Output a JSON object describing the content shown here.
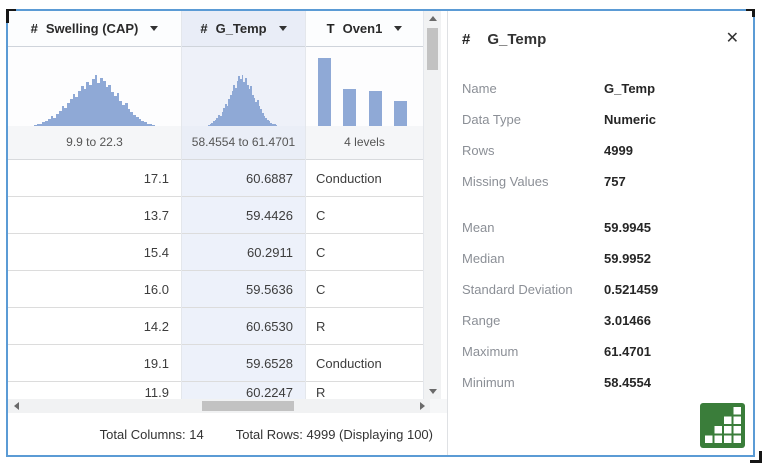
{
  "colors": {
    "accent_bar": "#8fa9d6",
    "frame_border": "#5b9bd5",
    "chart_icon_green": "#3a7d3a"
  },
  "table": {
    "columns": [
      {
        "icon": "#",
        "label": "Swelling (CAP)",
        "range": "9.9 to 22.3",
        "selected": false,
        "kind": "numeric",
        "hist_bars": [
          2,
          3,
          4,
          6,
          8,
          10,
          14,
          12,
          18,
          22,
          28,
          25,
          33,
          38,
          45,
          41,
          50,
          56,
          52,
          62,
          58,
          66,
          72,
          60,
          68,
          63,
          55,
          58,
          48,
          43,
          46,
          36,
          30,
          33,
          24,
          20,
          16,
          13,
          10,
          8,
          6,
          4,
          3,
          2
        ]
      },
      {
        "icon": "#",
        "label": "G_Temp",
        "range": "58.4554 to 61.4701",
        "selected": true,
        "kind": "numeric",
        "hist_bars": [
          2,
          3,
          5,
          7,
          9,
          12,
          16,
          14,
          20,
          26,
          31,
          28,
          38,
          44,
          50,
          58,
          54,
          64,
          70,
          66,
          72,
          62,
          68,
          58,
          52,
          56,
          44,
          40,
          34,
          37,
          28,
          24,
          19,
          15,
          12,
          9,
          7,
          5,
          4,
          3,
          2,
          1
        ]
      },
      {
        "icon": "T",
        "label": "Oven1",
        "range": "4 levels",
        "selected": false,
        "kind": "categorical",
        "hist_bars": [
          95,
          52,
          50,
          35
        ]
      }
    ],
    "rows": [
      [
        "17.1",
        "60.6887",
        "Conduction"
      ],
      [
        "13.7",
        "59.4426",
        "C"
      ],
      [
        "15.4",
        "60.2911",
        "C"
      ],
      [
        "16.0",
        "59.5636",
        "C"
      ],
      [
        "14.2",
        "60.6530",
        "R"
      ],
      [
        "19.1",
        "59.6528",
        "Conduction"
      ],
      [
        "11.9",
        "60.2247",
        "R"
      ]
    ],
    "footer": {
      "total_columns": "Total Columns: 14",
      "total_rows": "Total Rows: 4999 (Displaying 100)"
    }
  },
  "panel": {
    "icon": "#",
    "title": "G_Temp",
    "close_icon": "✕",
    "groups": [
      [
        {
          "label": "Name",
          "value": "G_Temp"
        },
        {
          "label": "Data Type",
          "value": "Numeric"
        },
        {
          "label": "Rows",
          "value": "4999"
        },
        {
          "label": "Missing Values",
          "value": "757"
        }
      ],
      [
        {
          "label": "Mean",
          "value": "59.9945"
        },
        {
          "label": "Median",
          "value": "59.9952"
        },
        {
          "label": "Standard Deviation",
          "value": "0.521459"
        },
        {
          "label": "Range",
          "value": "3.01466"
        },
        {
          "label": "Maximum",
          "value": "61.4701"
        },
        {
          "label": "Minimum",
          "value": "58.4554"
        }
      ]
    ]
  }
}
